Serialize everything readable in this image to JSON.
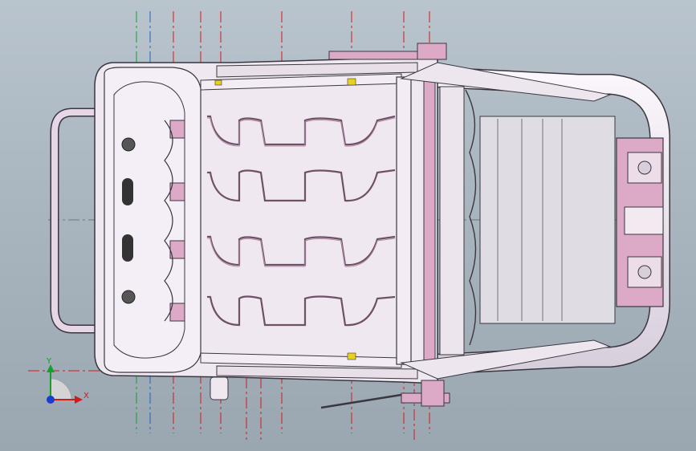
{
  "view": {
    "background_top": "#b9c4cd",
    "background_bottom": "#9aa6b0",
    "model": "seat-frame",
    "orientation": "top-view"
  },
  "colors": {
    "frame_fill": "#efe8f1",
    "frame_stroke": "#3a3740",
    "accent_pink": "#d9a7c2",
    "spring_wire": "#7a5a72",
    "centerline_red": "#d11b1b",
    "centerline_green": "#14a02a",
    "centerline_blue": "#1c63c8",
    "marker_yellow": "#e6d21a"
  },
  "triad": {
    "x_label": "X",
    "y_label": "Y",
    "x_color": "#d11b1b",
    "y_color": "#14a02a",
    "z_color": "#1c3bd1"
  }
}
